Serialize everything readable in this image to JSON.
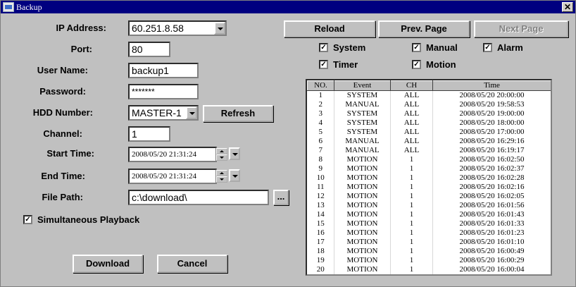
{
  "window": {
    "title": "Backup"
  },
  "form": {
    "ip_label": "IP Address:",
    "ip_value": "60.251.8.58",
    "port_label": "Port:",
    "port_value": "80",
    "user_label": "User Name:",
    "user_value": "backup1",
    "password_label": "Password:",
    "password_value": "*******",
    "hdd_label": "HDD Number:",
    "hdd_value": "MASTER-1",
    "refresh_label": "Refresh",
    "channel_label": "Channel:",
    "channel_value": "1",
    "start_label": "Start Time:",
    "start_value": "2008/05/20 21:31:24",
    "end_label": "End Time:",
    "end_value": "2008/05/20 21:31:24",
    "path_label": "File Path:",
    "path_value": "c:\\download\\",
    "browse_label": "...",
    "simultaneous_label": "Simultaneous Playback",
    "simultaneous_checked": true,
    "download_label": "Download",
    "cancel_label": "Cancel"
  },
  "toolbar": {
    "reload_label": "Reload",
    "prev_label": "Prev. Page",
    "next_label": "Next Page"
  },
  "filters": [
    {
      "label": "System",
      "checked": true
    },
    {
      "label": "Manual",
      "checked": true
    },
    {
      "label": "Alarm",
      "checked": true
    },
    {
      "label": "Timer",
      "checked": true
    },
    {
      "label": "Motion",
      "checked": true
    }
  ],
  "events": {
    "columns": [
      "NO.",
      "Event",
      "CH",
      "Time"
    ],
    "rows": [
      [
        "1",
        "SYSTEM",
        "ALL",
        "2008/05/20 20:00:00"
      ],
      [
        "2",
        "MANUAL",
        "ALL",
        "2008/05/20 19:58:53"
      ],
      [
        "3",
        "SYSTEM",
        "ALL",
        "2008/05/20 19:00:00"
      ],
      [
        "4",
        "SYSTEM",
        "ALL",
        "2008/05/20 18:00:00"
      ],
      [
        "5",
        "SYSTEM",
        "ALL",
        "2008/05/20 17:00:00"
      ],
      [
        "6",
        "MANUAL",
        "ALL",
        "2008/05/20 16:29:16"
      ],
      [
        "7",
        "MANUAL",
        "ALL",
        "2008/05/20 16:19:17"
      ],
      [
        "8",
        "MOTION",
        "1",
        "2008/05/20 16:02:50"
      ],
      [
        "9",
        "MOTION",
        "1",
        "2008/05/20 16:02:37"
      ],
      [
        "10",
        "MOTION",
        "1",
        "2008/05/20 16:02:28"
      ],
      [
        "11",
        "MOTION",
        "1",
        "2008/05/20 16:02:16"
      ],
      [
        "12",
        "MOTION",
        "1",
        "2008/05/20 16:02:05"
      ],
      [
        "13",
        "MOTION",
        "1",
        "2008/05/20 16:01:56"
      ],
      [
        "14",
        "MOTION",
        "1",
        "2008/05/20 16:01:43"
      ],
      [
        "15",
        "MOTION",
        "1",
        "2008/05/20 16:01:33"
      ],
      [
        "16",
        "MOTION",
        "1",
        "2008/05/20 16:01:23"
      ],
      [
        "17",
        "MOTION",
        "1",
        "2008/05/20 16:01:10"
      ],
      [
        "18",
        "MOTION",
        "1",
        "2008/05/20 16:00:49"
      ],
      [
        "19",
        "MOTION",
        "1",
        "2008/05/20 16:00:29"
      ],
      [
        "20",
        "MOTION",
        "1",
        "2008/05/20 16:00:04"
      ]
    ]
  }
}
